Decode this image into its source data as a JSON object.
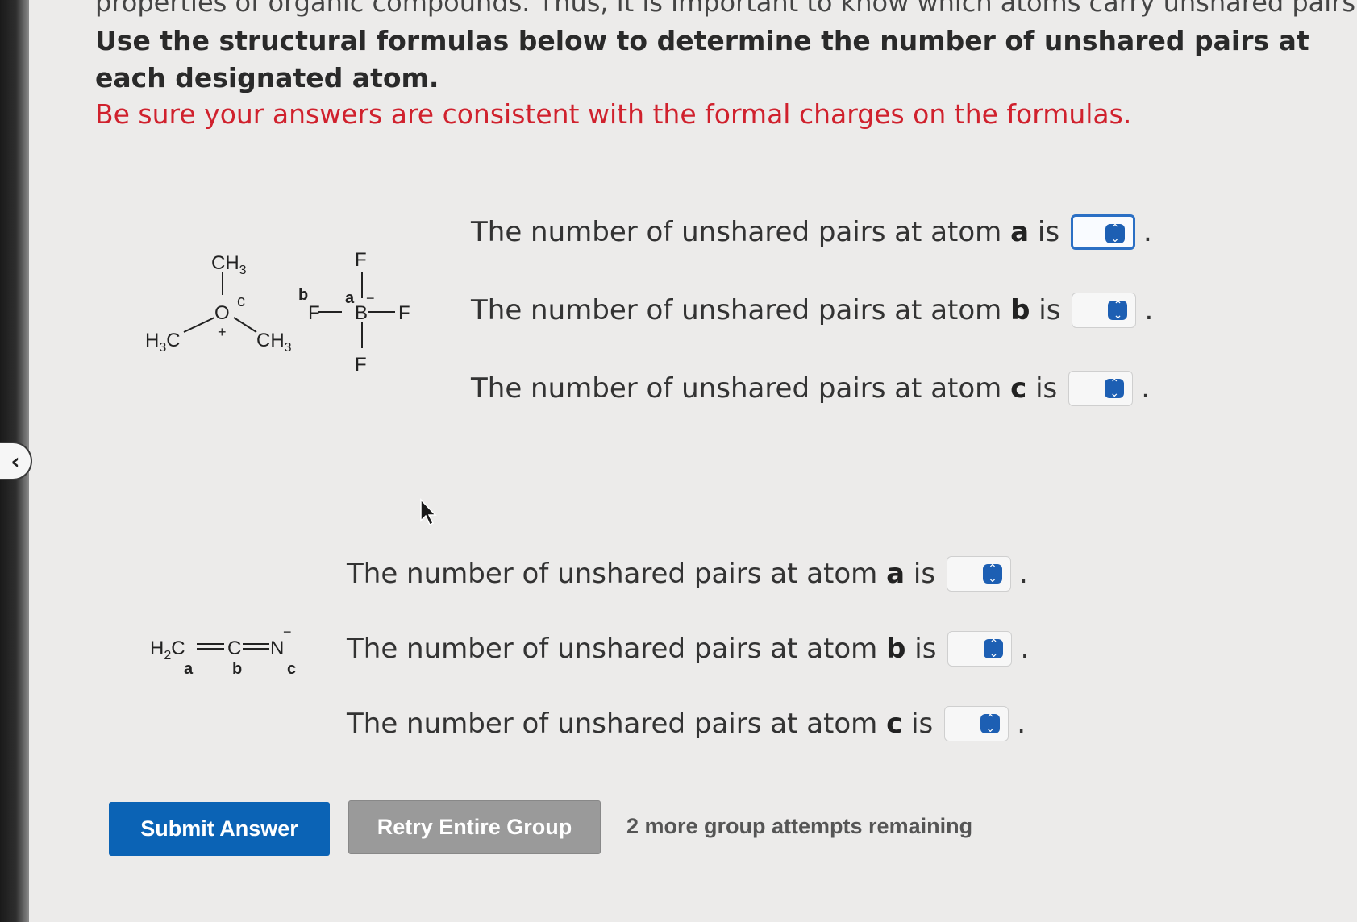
{
  "header": {
    "cut_line": "properties of organic compounds. Thus, it is important to know which atoms carry unshared pairs.",
    "instruction": "Use the structural formulas below to determine the number of unshared pairs at each designated atom.",
    "warning": "Be sure your answers are consistent with the formal charges on the formulas."
  },
  "molecule1": {
    "ch3_top": "CH",
    "sub3": "3",
    "o": "O",
    "c_label": "c",
    "plus": "+",
    "h3c": "H",
    "c_atom": "C",
    "ch3_right": "CH",
    "b_label": "b",
    "a_label": "a",
    "f": "F",
    "b_atom": "B",
    "minus": "−"
  },
  "molecule2": {
    "h": "H",
    "sub2": "2",
    "c": "C",
    "n": "N",
    "minus": "−",
    "a": "a",
    "b": "b",
    "c_label": "c"
  },
  "group1": {
    "prefix": "The number of unshared pairs at atom",
    "is": "is",
    "rows": [
      {
        "atom": "a",
        "value": ""
      },
      {
        "atom": "b",
        "value": ""
      },
      {
        "atom": "c",
        "value": ""
      }
    ]
  },
  "group2": {
    "prefix": "The number of unshared pairs at atom",
    "is": "is",
    "rows": [
      {
        "atom": "a",
        "value": ""
      },
      {
        "atom": "b",
        "value": ""
      },
      {
        "atom": "c",
        "value": ""
      }
    ]
  },
  "buttons": {
    "submit": "Submit Answer",
    "retry": "Retry Entire Group"
  },
  "status": {
    "attempts": "2 more group attempts remaining"
  },
  "colors": {
    "warning": "#d0212d",
    "submit": "#0b63b5",
    "retry": "#9a9a9a",
    "select_icon": "#1d5fb3"
  }
}
